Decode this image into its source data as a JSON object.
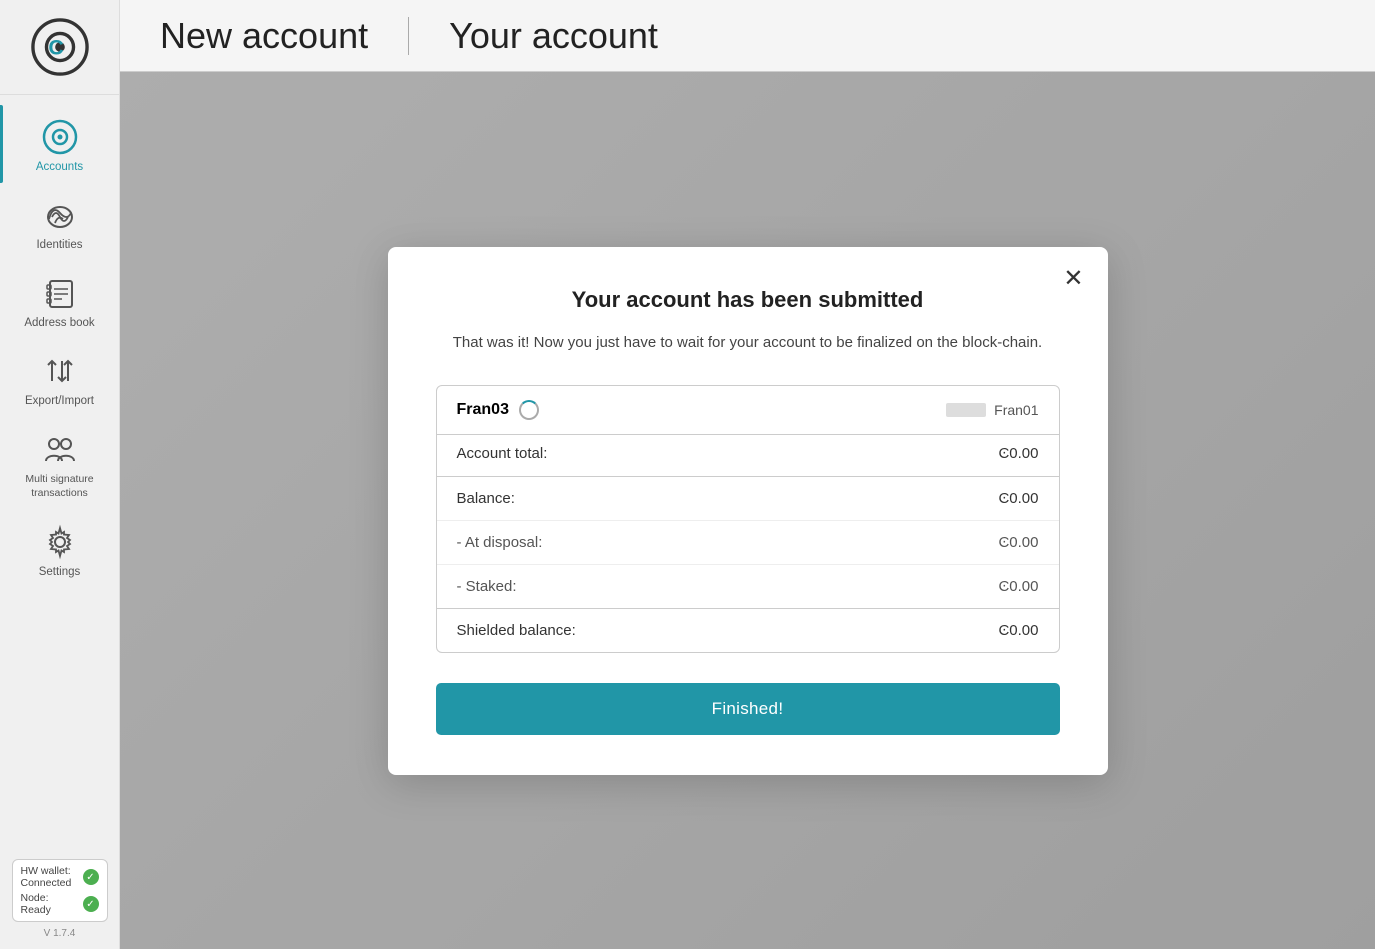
{
  "sidebar": {
    "logo_alt": "Concordium logo",
    "items": [
      {
        "id": "accounts",
        "label": "Accounts",
        "active": true
      },
      {
        "id": "identities",
        "label": "Identities",
        "active": false
      },
      {
        "id": "address-book",
        "label": "Address book",
        "active": false
      },
      {
        "id": "export-import",
        "label": "Export/Import",
        "active": false
      },
      {
        "id": "multi-sig",
        "label": "Multi signature transactions",
        "active": false
      },
      {
        "id": "settings",
        "label": "Settings",
        "active": false
      }
    ],
    "hw_wallet_label": "HW wallet:",
    "hw_wallet_status": "Connected",
    "node_label": "Node:",
    "node_status": "Ready",
    "version": "V 1.7.4"
  },
  "topbar": {
    "left_title": "New account",
    "right_title": "Your account"
  },
  "modal": {
    "title": "Your account has been submitted",
    "description": "That was it! Now you just have to wait for your account to be finalized on the block-chain.",
    "account_name": "Fran03",
    "account_identity": "Fran01",
    "account_total_label": "Account total:",
    "account_total_value": "Ͼ0.00",
    "balance_label": "Balance:",
    "balance_value": "Ͼ0.00",
    "at_disposal_label": "- At disposal:",
    "at_disposal_value": "Ͼ0.00",
    "staked_label": "- Staked:",
    "staked_value": "Ͼ0.00",
    "shielded_label": "Shielded balance:",
    "shielded_value": "Ͼ0.00",
    "finished_button": "Finished!"
  }
}
